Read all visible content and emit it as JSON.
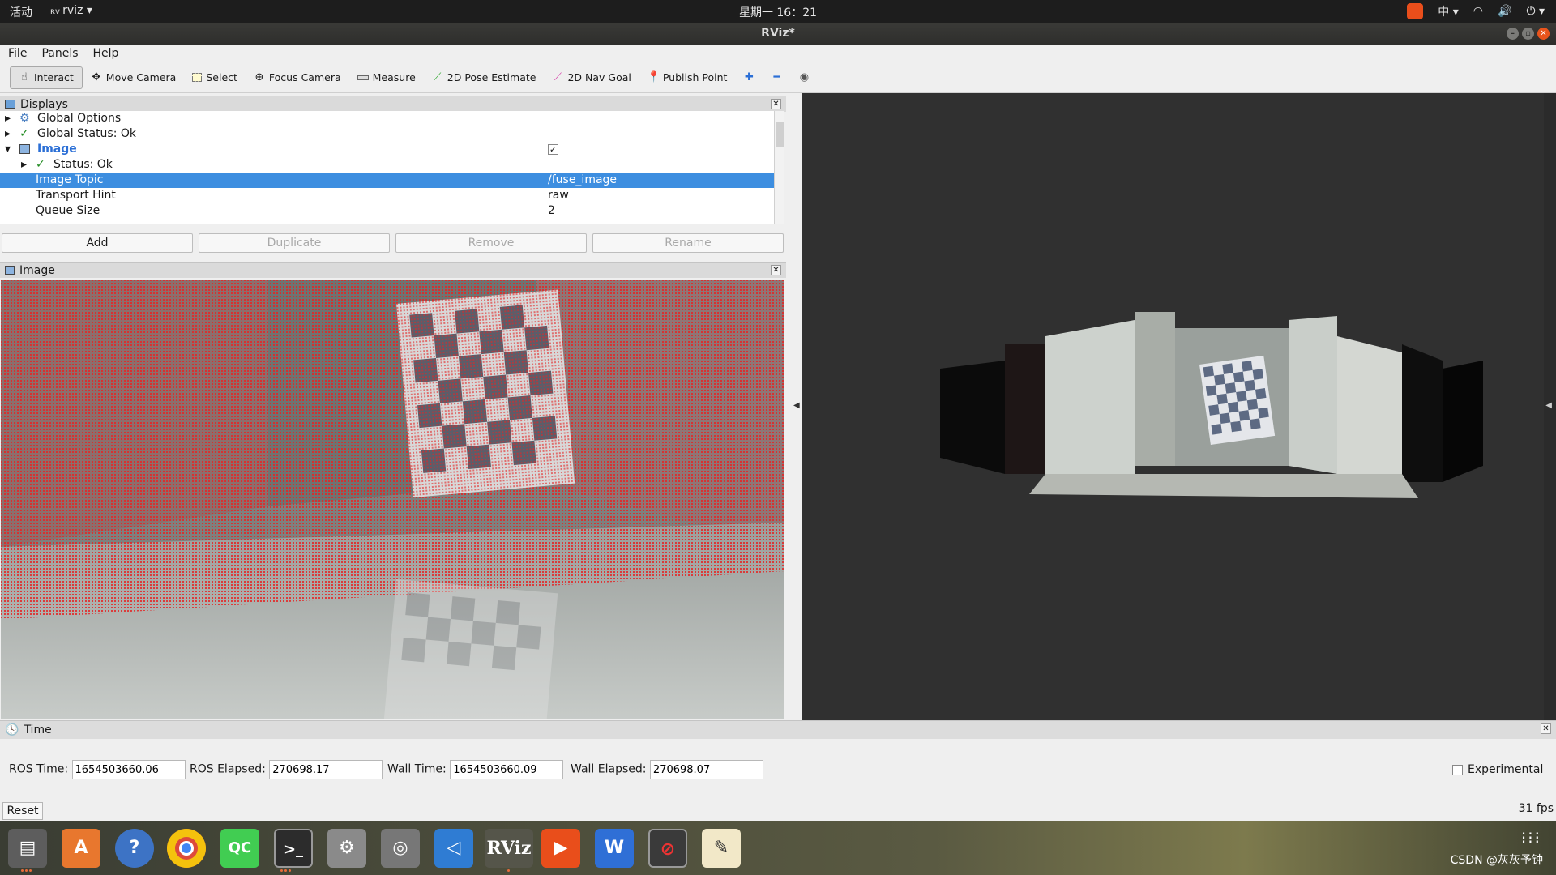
{
  "topbar": {
    "activities": "活动",
    "app_name": "rviz",
    "clock": "星期一 16：21",
    "input_method": "中"
  },
  "window": {
    "title": "RViz*"
  },
  "menu": [
    "File",
    "Panels",
    "Help"
  ],
  "toolbar": [
    {
      "label": "Interact",
      "icon": "hand-icon",
      "active": true
    },
    {
      "label": "Move Camera",
      "icon": "move-icon"
    },
    {
      "label": "Select",
      "icon": "select-icon"
    },
    {
      "label": "Focus Camera",
      "icon": "focus-icon"
    },
    {
      "label": "Measure",
      "icon": "ruler-icon"
    },
    {
      "label": "2D Pose Estimate",
      "icon": "arrow-green-icon"
    },
    {
      "label": "2D Nav Goal",
      "icon": "arrow-pink-icon"
    },
    {
      "label": "Publish Point",
      "icon": "pin-icon"
    }
  ],
  "displays": {
    "title": "Displays",
    "rows": [
      {
        "name": "Global Options",
        "value": ""
      },
      {
        "name": "Global Status: Ok",
        "value": ""
      },
      {
        "name": "Image",
        "value": "✓"
      },
      {
        "name": "Status: Ok",
        "value": ""
      },
      {
        "name": "Image Topic",
        "value": "/fuse_image"
      },
      {
        "name": "Transport Hint",
        "value": "raw"
      },
      {
        "name": "Queue Size",
        "value": "2"
      }
    ],
    "buttons": [
      "Add",
      "Duplicate",
      "Remove",
      "Rename"
    ]
  },
  "image_panel": {
    "title": "Image"
  },
  "time": {
    "title": "Time",
    "ros_time_label": "ROS Time:",
    "ros_time": "1654503660.06",
    "ros_elapsed_label": "ROS Elapsed:",
    "ros_elapsed": "270698.17",
    "wall_time_label": "Wall Time:",
    "wall_time": "1654503660.09",
    "wall_elapsed_label": "Wall Elapsed:",
    "wall_elapsed": "270698.07",
    "experimental": "Experimental",
    "reset": "Reset",
    "fps": "31 fps"
  },
  "taskbar": {
    "watermark": "CSDN @灰灰予钟",
    "rviz_label": "RViz",
    "qc_label": "QC"
  }
}
